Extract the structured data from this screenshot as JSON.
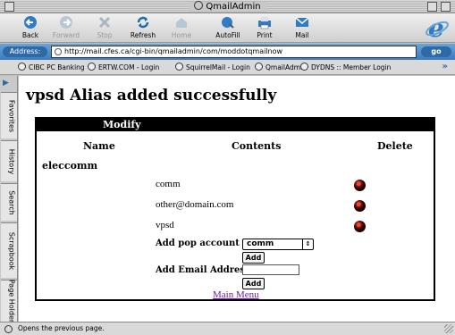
{
  "window": {
    "title": "QmailAdmin"
  },
  "toolbar": {
    "buttons": [
      {
        "label": "Back",
        "icon": "back-arrow-icon",
        "enabled": true
      },
      {
        "label": "Forward",
        "icon": "forward-arrow-icon",
        "enabled": false
      },
      {
        "label": "Stop",
        "icon": "stop-icon",
        "enabled": false
      },
      {
        "label": "Refresh",
        "icon": "refresh-icon",
        "enabled": true
      },
      {
        "label": "Home",
        "icon": "home-icon",
        "enabled": false
      },
      {
        "label": "AutoFill",
        "icon": "autofill-icon",
        "enabled": true
      },
      {
        "label": "Print",
        "icon": "print-icon",
        "enabled": true
      },
      {
        "label": "Mail",
        "icon": "mail-icon",
        "enabled": true
      }
    ]
  },
  "address": {
    "label": "Address:",
    "url": "http://mail.cfes.ca/cgi-bin/qmailadmin/com/moddotqmailnow",
    "go_label": "go"
  },
  "favorites": [
    "CIBC PC Banking",
    "ERTW.COM - Login",
    "SquirrelMail - Login",
    "QmailAdmin",
    "DYDNS :: Member Login"
  ],
  "favorites_more": "»",
  "sidebar_tabs": [
    "Favorites",
    "History",
    "Search",
    "Scrapbook",
    "Page Holder"
  ],
  "page": {
    "title": "vpsd Alias added successfully",
    "panel_title": "Modify",
    "columns": {
      "name": "Name",
      "contents": "Contents",
      "delete": "Delete"
    },
    "alias_name": "eleccomm",
    "destinations": [
      "comm",
      "other@domain.com",
      "vpsd"
    ],
    "add_pop_label": "Add pop account",
    "pop_selected": "comm",
    "add_button_label": "Add",
    "add_email_label": "Add Email Address",
    "email_value": "",
    "main_menu_link": "Main Menu"
  },
  "status": {
    "text": "Opens the previous page."
  },
  "colors": {
    "accent": "#3b7bbf",
    "link_visited": "#6b1c9e",
    "delete_button": "#8a1508"
  }
}
